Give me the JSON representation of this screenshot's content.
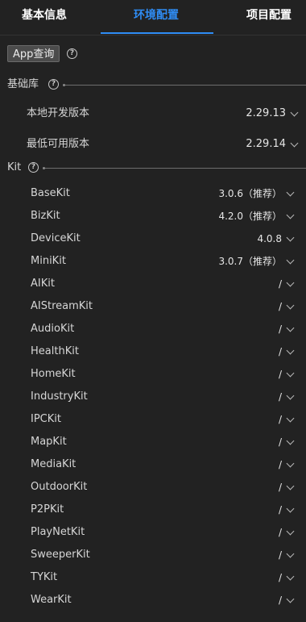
{
  "tabs": [
    {
      "label": "基本信息"
    },
    {
      "label": "环境配置"
    },
    {
      "label": "项目配置"
    }
  ],
  "active_tab": "环境配置",
  "colors": {
    "accent": "#2f8df5",
    "background": "#222222"
  },
  "app_query_button": "App查询",
  "base_lib": {
    "title": "基础库",
    "local_dev_version_label": "本地开发版本",
    "local_dev_version_value": "2.29.13",
    "min_usable_version_label": "最低可用版本",
    "min_usable_version_value": "2.29.14"
  },
  "kit_section": {
    "title": "Kit",
    "kits": [
      {
        "name": "BaseKit",
        "value": "3.0.6（推荐）"
      },
      {
        "name": "BizKit",
        "value": "4.2.0（推荐）"
      },
      {
        "name": "DeviceKit",
        "value": "4.0.8"
      },
      {
        "name": "MiniKit",
        "value": "3.0.7（推荐）"
      },
      {
        "name": "AIKit",
        "value": "/"
      },
      {
        "name": "AIStreamKit",
        "value": "/"
      },
      {
        "name": "AudioKit",
        "value": "/"
      },
      {
        "name": "HealthKit",
        "value": "/"
      },
      {
        "name": "HomeKit",
        "value": "/"
      },
      {
        "name": "IndustryKit",
        "value": "/"
      },
      {
        "name": "IPCKit",
        "value": "/"
      },
      {
        "name": "MapKit",
        "value": "/"
      },
      {
        "name": "MediaKit",
        "value": "/"
      },
      {
        "name": "OutdoorKit",
        "value": "/"
      },
      {
        "name": "P2PKit",
        "value": "/"
      },
      {
        "name": "PlayNetKit",
        "value": "/"
      },
      {
        "name": "SweeperKit",
        "value": "/"
      },
      {
        "name": "TYKit",
        "value": "/"
      },
      {
        "name": "WearKit",
        "value": "/"
      }
    ]
  },
  "icons": {
    "help": "help-circle-icon",
    "dropdown": "chevron-down-icon"
  }
}
